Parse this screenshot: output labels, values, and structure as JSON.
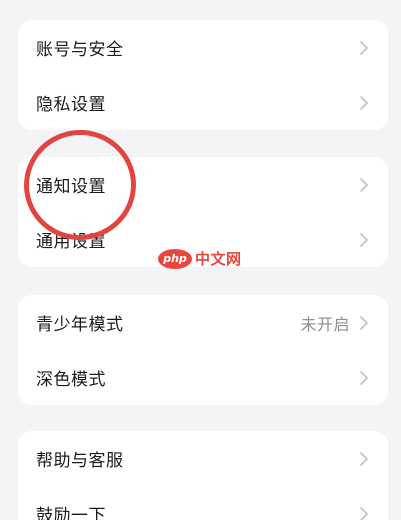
{
  "sections": [
    {
      "items": [
        {
          "label": "账号与安全",
          "value": ""
        },
        {
          "label": "隐私设置",
          "value": ""
        }
      ]
    },
    {
      "items": [
        {
          "label": "通知设置",
          "value": ""
        },
        {
          "label": "通用设置",
          "value": ""
        }
      ]
    },
    {
      "items": [
        {
          "label": "青少年模式",
          "value": "未开启"
        },
        {
          "label": "深色模式",
          "value": ""
        }
      ]
    },
    {
      "items": [
        {
          "label": "帮助与客服",
          "value": ""
        },
        {
          "label": "鼓励一下",
          "value": ""
        }
      ]
    }
  ],
  "watermark": {
    "logo_text": "php",
    "text": "中文网"
  },
  "colors": {
    "background": "#f4f4f6",
    "card": "#ffffff",
    "annotation": "#e0463f",
    "watermark": "#e8473d",
    "secondary_text": "#8e8e93"
  },
  "icons": {
    "row_arrow": "chevron-right-icon"
  }
}
